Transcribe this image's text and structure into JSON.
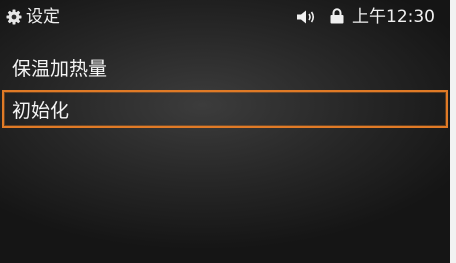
{
  "status_bar": {
    "title": "设定",
    "time": "上午12:30",
    "icons": [
      "gear-icon",
      "speaker-icon",
      "lock-icon"
    ]
  },
  "menu": {
    "items": [
      {
        "label": "保温加热量",
        "selected": false
      },
      {
        "label": "初始化",
        "selected": true
      }
    ]
  },
  "colors": {
    "highlight": "#e07a26",
    "text": "#f0f0f0",
    "background": "#262626"
  }
}
